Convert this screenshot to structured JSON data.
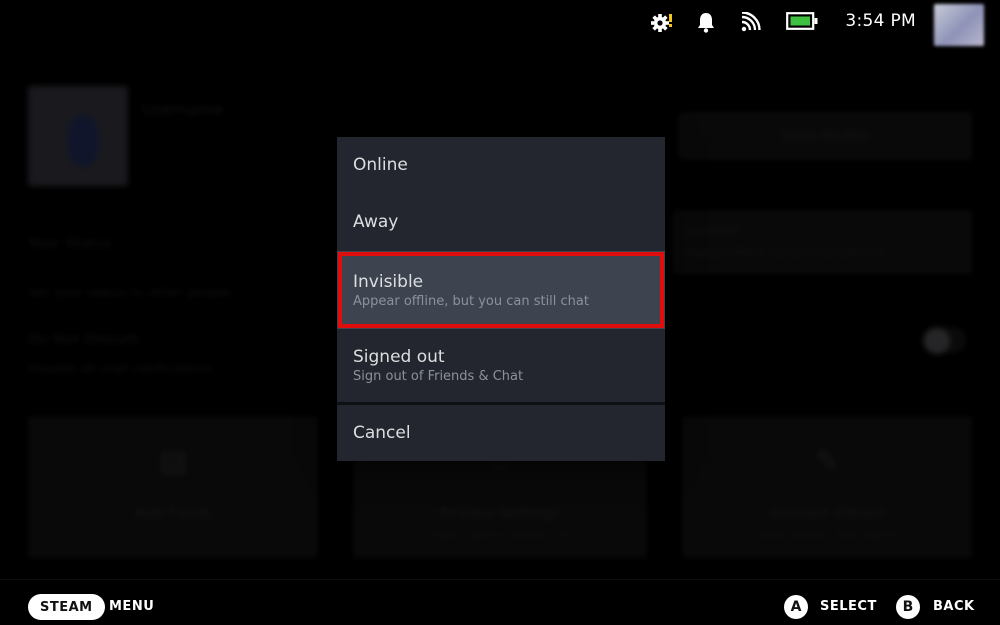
{
  "status_bar": {
    "time": "3:54 PM",
    "icons": [
      "settings-alert-icon",
      "notification-bell-icon",
      "wifi-icon",
      "battery-icon"
    ],
    "colors": {
      "battery_fill": "#3fbf3f",
      "settings_alert": "#f5c518"
    }
  },
  "background": {
    "profile_name": "Username",
    "view_profile_label": "View Profile",
    "your_status_label": "Your Status",
    "your_status_desc": "Set your status to other people",
    "status_select_value": "Invisible",
    "status_select_desc": "Appear offline, but you can still chat",
    "dnd_label": "Do Not Disturb",
    "dnd_desc": "Disable all chat notifications",
    "cards": [
      {
        "title": "Add Funds",
        "subtitle": "",
        "icon": "wallet-icon"
      },
      {
        "title": "Privacy Settings",
        "subtitle": "Public Game Details etc",
        "icon": "privacy-icon"
      },
      {
        "title": "Account Details",
        "subtitle": "View Details Edit Name",
        "icon": "pencil-icon"
      }
    ]
  },
  "status_dialog": {
    "options": [
      {
        "title": "Online",
        "subtitle": ""
      },
      {
        "title": "Away",
        "subtitle": ""
      },
      {
        "title": "Invisible",
        "subtitle": "Appear offline, but you can still chat"
      },
      {
        "title": "Signed out",
        "subtitle": "Sign out of Friends & Chat"
      }
    ],
    "selected": "Invisible",
    "cancel_label": "Cancel",
    "colors": {
      "dialog_bg": "#23262e",
      "selected_bg": "#3d4450",
      "highlight_border": "#e00d0d"
    }
  },
  "footer": {
    "steam_label": "STEAM",
    "menu_label": "MENU",
    "a_glyph": "A",
    "select_label": "SELECT",
    "b_glyph": "B",
    "back_label": "BACK"
  }
}
